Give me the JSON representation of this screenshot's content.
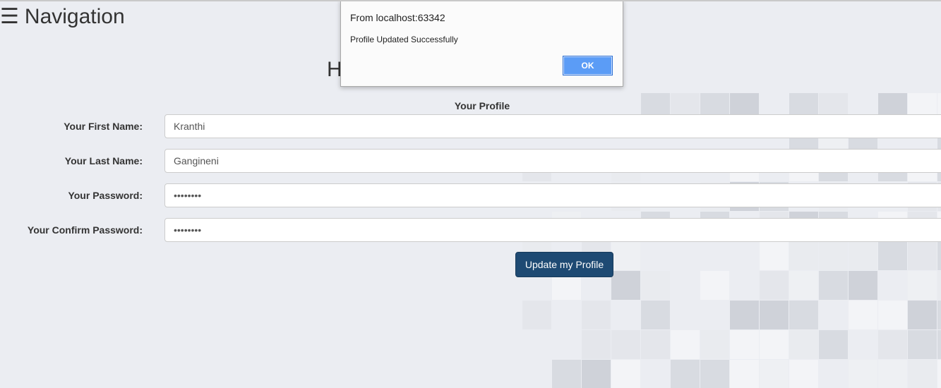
{
  "nav": {
    "icon": "hamburger-icon",
    "label": "Navigation"
  },
  "heading": {
    "visible_text": "H                                      m"
  },
  "form": {
    "title": "Your Profile",
    "fields": [
      {
        "label": "Your First Name:",
        "value": "Kranthi"
      },
      {
        "label": "Your Last Name:",
        "value": "Gangineni"
      },
      {
        "label": "Your Password:",
        "value": "••••••••"
      },
      {
        "label": "Your Confirm Password:",
        "value": "••••••••"
      }
    ],
    "submit_label": "Update my Profile"
  },
  "alert": {
    "title": "From localhost:63342",
    "message": "Profile Updated Successfully",
    "ok_label": "OK"
  },
  "colors": {
    "background": "#ebedf2",
    "button": "#1e4a73",
    "dialog_ok": "#5b9cf6"
  }
}
